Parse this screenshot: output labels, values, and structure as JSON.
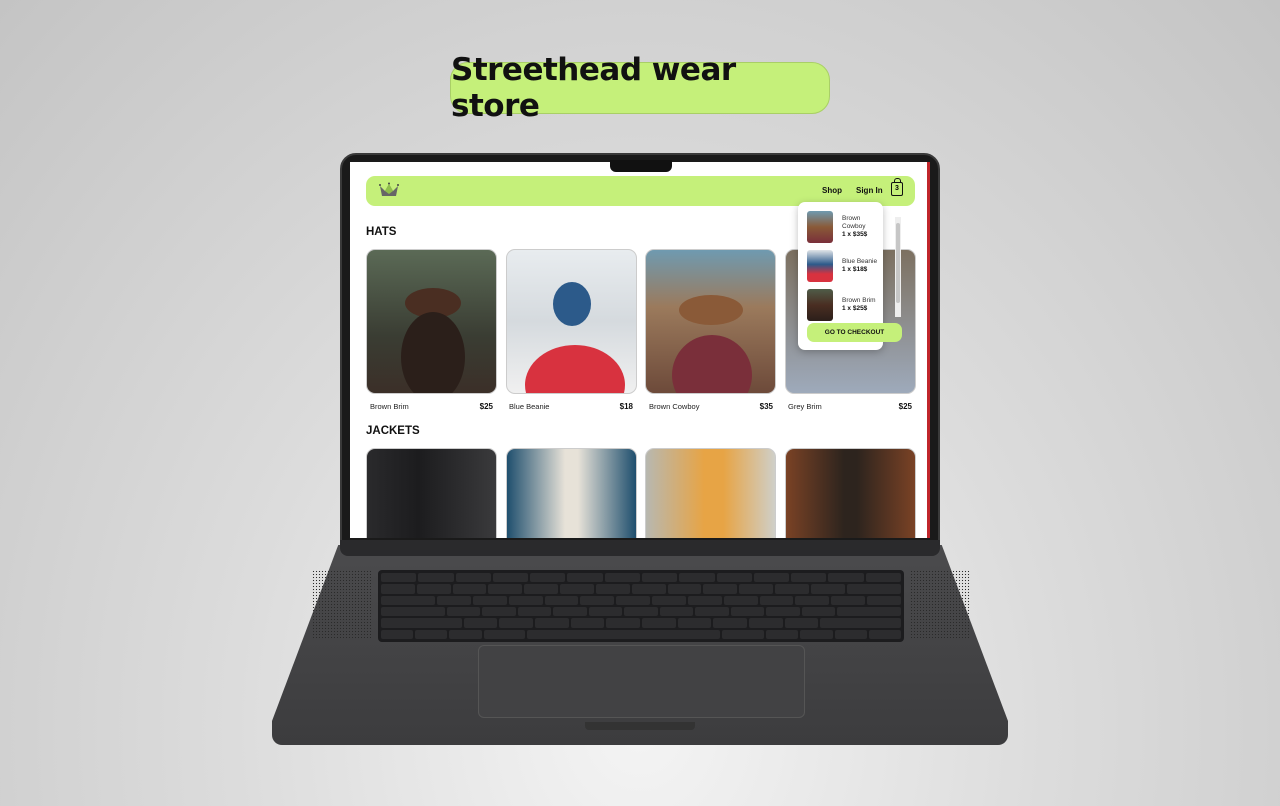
{
  "headline": "Streethead wear store",
  "nav": {
    "shop": "Shop",
    "signin": "Sign In",
    "cart_count": "3"
  },
  "sections": [
    {
      "title": "HATS",
      "items": [
        {
          "name": "Brown Brim",
          "price": "$25"
        },
        {
          "name": "Blue Beanie",
          "price": "$18"
        },
        {
          "name": "Brown Cowboy",
          "price": "$35"
        },
        {
          "name": "Grey Brim",
          "price": "$25"
        }
      ]
    },
    {
      "title": "JACKETS"
    }
  ],
  "cart": {
    "items": [
      {
        "name": "Brown Cowboy",
        "qty": "1 x $35$"
      },
      {
        "name": "Blue Beanie",
        "qty": "1 x $18$"
      },
      {
        "name": "Brown Brim",
        "qty": "1 x $25$"
      }
    ],
    "checkout": "GO TO CHECKOUT"
  },
  "colors": {
    "accent": "#c5f07a"
  }
}
